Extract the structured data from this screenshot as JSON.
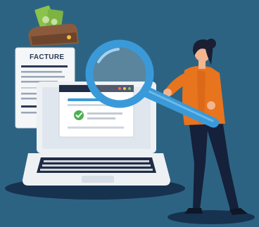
{
  "invoice": {
    "title": "FACTURE"
  },
  "colors": {
    "background": "#2d6382",
    "floor_shadow": "#17324f",
    "paper": "#f4f6f8",
    "laptop_body": "#eef1f4",
    "laptop_dark": "#1f2d45",
    "magnifier_blue": "#3a9ad9",
    "check_green": "#4caf50",
    "money_green": "#8bc34a",
    "wallet_brown": "#8b5a3c",
    "shirt_orange": "#e8741e",
    "pants_navy": "#15203a",
    "hair_dark": "#1a1f33",
    "skin": "#f1b58f"
  },
  "icons": [
    "wallet-icon",
    "money-bills-icon",
    "check-icon",
    "magnifier-icon",
    "laptop-icon",
    "invoice-icon"
  ]
}
